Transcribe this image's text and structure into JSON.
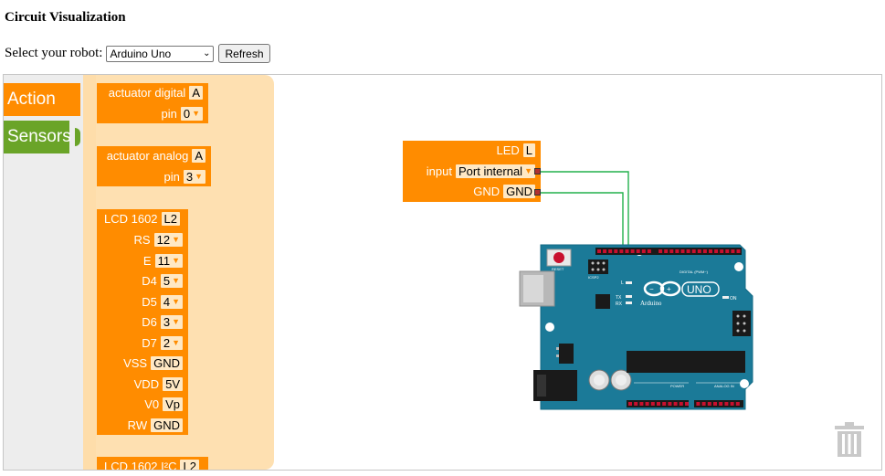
{
  "page": {
    "title": "Circuit Visualization"
  },
  "robot": {
    "label": "Select your robot:",
    "selected": "Arduino Uno",
    "refresh_label": "Refresh"
  },
  "toolbox": {
    "categories": [
      {
        "label": "Action",
        "color": "#ff8c00"
      },
      {
        "label": "Sensors",
        "color": "#6aa428"
      }
    ]
  },
  "flyout": {
    "actuator_digital": {
      "title": "actuator digital",
      "title_field": "A",
      "pin_label": "pin",
      "pin_value": "0"
    },
    "actuator_analog": {
      "title": "actuator analog",
      "title_field": "A",
      "pin_label": "pin",
      "pin_value": "3"
    },
    "lcd1602": {
      "title": "LCD 1602",
      "title_field": "L2",
      "rows": [
        {
          "label": "RS",
          "value": "12",
          "dropdown": true
        },
        {
          "label": "E",
          "value": "11",
          "dropdown": true
        },
        {
          "label": "D4",
          "value": "5",
          "dropdown": true
        },
        {
          "label": "D5",
          "value": "4",
          "dropdown": true
        },
        {
          "label": "D6",
          "value": "3",
          "dropdown": true
        },
        {
          "label": "D7",
          "value": "2",
          "dropdown": true
        },
        {
          "label": "VSS",
          "value": "GND",
          "dropdown": false
        },
        {
          "label": "VDD",
          "value": "5V",
          "dropdown": false
        },
        {
          "label": "V0",
          "value": "Vp",
          "dropdown": false
        },
        {
          "label": "RW",
          "value": "GND",
          "dropdown": false
        }
      ]
    },
    "lcd1602_i2c": {
      "title": "LCD 1602 I²C",
      "title_field": "L2"
    }
  },
  "led_block": {
    "title": "LED",
    "title_field": "L",
    "input_label": "input",
    "input_value": "Port internal",
    "gnd_label": "GND",
    "gnd_value": "GND"
  },
  "board": {
    "name": "Arduino Uno",
    "logo_text": "UNO",
    "brand_text": "Arduino",
    "reset_label": "RESET",
    "icsp_label": "ICSP2",
    "icsp1_label": "ICSP",
    "digital_label": "DIGITAL (PWM~)",
    "power_label": "POWER",
    "analog_label": "ANALOG IN",
    "on_label": "ON",
    "tx_label": "TX",
    "rx_label": "RX",
    "l_label": "L",
    "board_color": "#1b7a98",
    "wire_color": "#22b14c"
  },
  "colors": {
    "block": "#ff8c00",
    "field_bg": "#ffe8c4",
    "flyout_bg": "#fedda9"
  }
}
